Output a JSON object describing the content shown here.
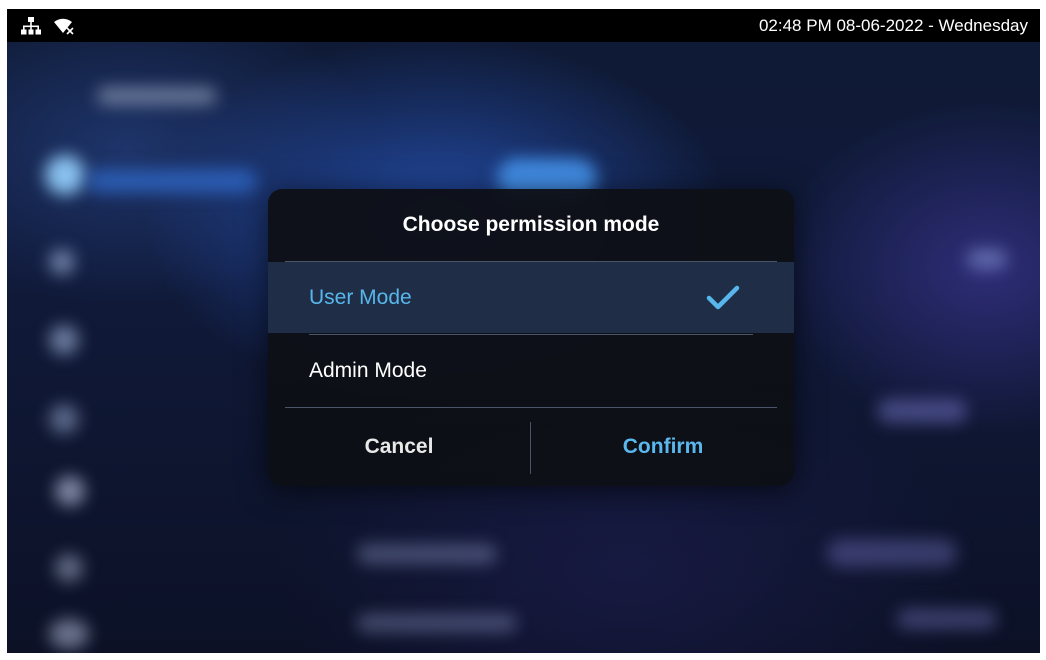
{
  "status_bar": {
    "datetime": "02:48 PM  08-06-2022 - Wednesday",
    "icons": [
      "network-icon",
      "wifi-disconnected-icon"
    ]
  },
  "dialog": {
    "title": "Choose permission mode",
    "options": [
      {
        "label": "User Mode",
        "selected": true
      },
      {
        "label": "Admin Mode",
        "selected": false
      }
    ],
    "cancel_label": "Cancel",
    "confirm_label": "Confirm"
  },
  "colors": {
    "accent": "#57b6ec",
    "selected_row_bg": "#1f2e46",
    "dialog_bg": "#0e1016"
  }
}
